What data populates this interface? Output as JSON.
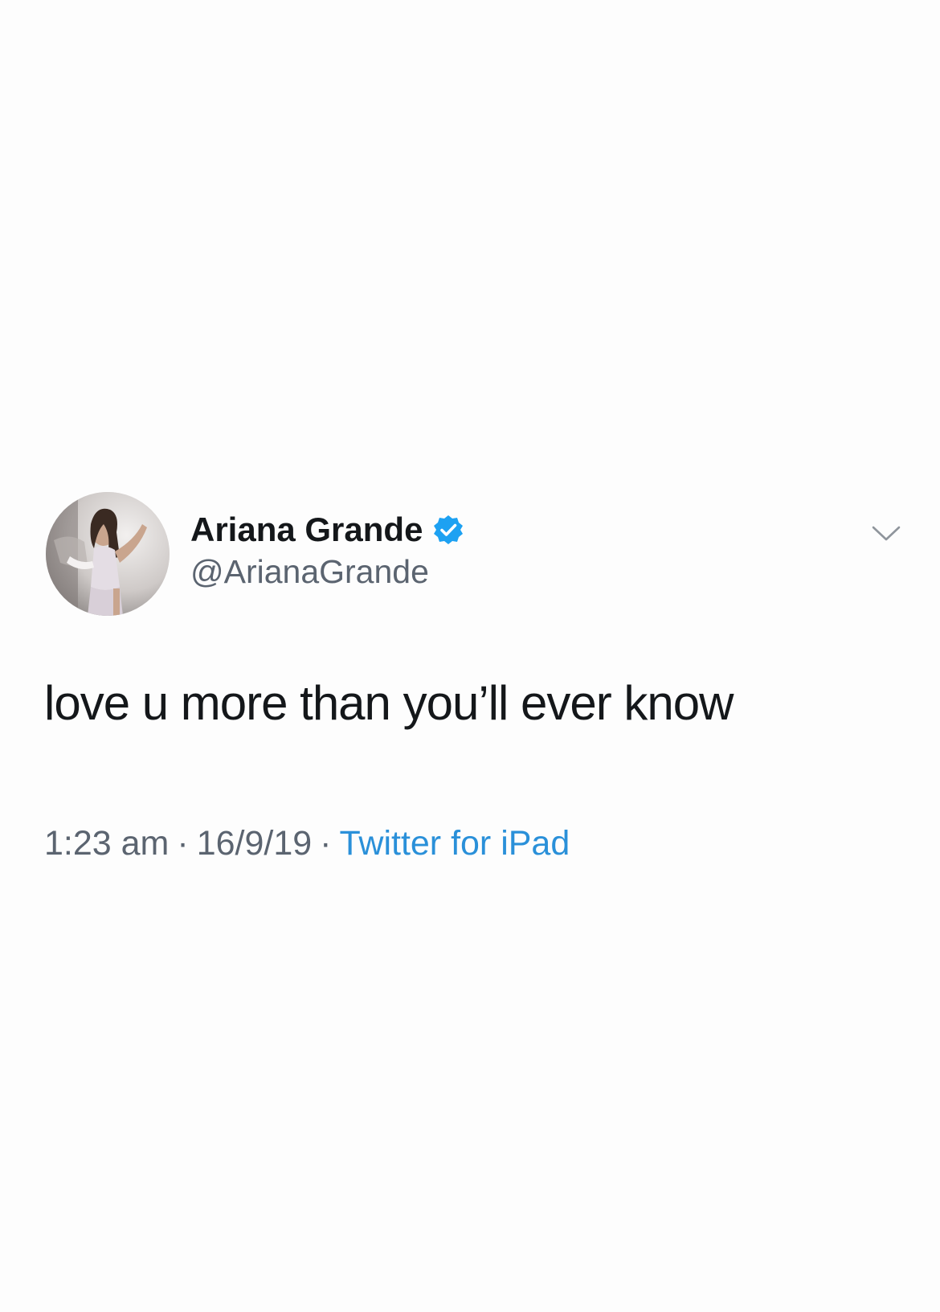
{
  "author": {
    "display_name": "Ariana Grande",
    "handle": "@ArianaGrande",
    "verified": true
  },
  "tweet": {
    "text": "love u more than you’ll ever know"
  },
  "meta": {
    "time": "1:23 am",
    "separator": "·",
    "date": "16/9/19",
    "source": "Twitter for iPad"
  },
  "icons": {
    "verified": "verified-badge-icon",
    "more": "chevron-down-icon"
  },
  "colors": {
    "verified_blue": "#1da1f2",
    "link_blue": "#2a90d9",
    "secondary_text": "#5b6470",
    "primary_text": "#14171a",
    "background": "#fdfdfd"
  }
}
